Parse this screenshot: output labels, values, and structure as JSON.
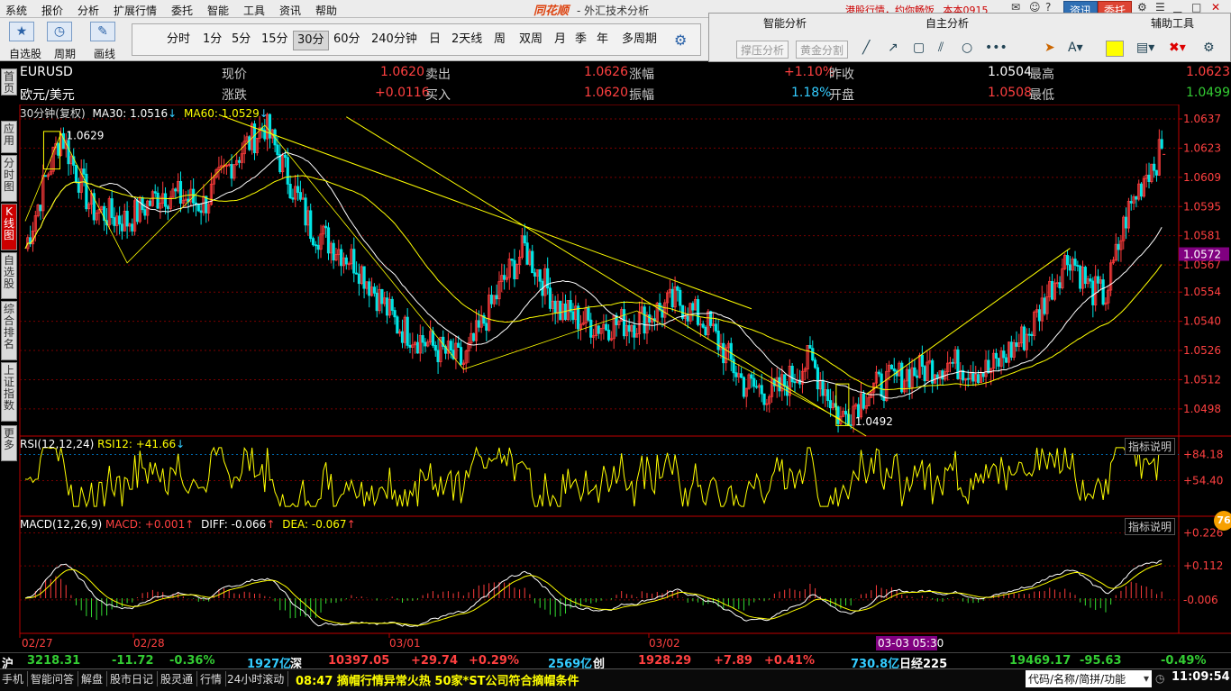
{
  "menu": [
    "系统",
    "报价",
    "分析",
    "扩展行情",
    "委托",
    "智能",
    "工具",
    "资讯",
    "帮助"
  ],
  "brand": "同花顺",
  "subtitle": "- 外汇技术分析",
  "notice": "港股行情，约你畅饭",
  "notice_user": "本本0915",
  "tab_news": "资讯",
  "tab_trade": "委托",
  "toolbar": {
    "captions": [
      "自选股",
      "周期",
      "画线"
    ],
    "periods": [
      "分时",
      "1分",
      "5分",
      "15分",
      "30分",
      "60分",
      "240分钟",
      "日",
      "2天线",
      "周",
      "双周",
      "月",
      "季",
      "年",
      "多周期"
    ],
    "active_period": "30分"
  },
  "right_panel": {
    "smart": "智能分析",
    "self": "自主分析",
    "aux": "辅助工具",
    "btn1": "撑压分析",
    "btn2": "黄金分割"
  },
  "sidebar": [
    "首页",
    "应用",
    "分时图",
    "K线图",
    "自选股",
    "综合排名",
    "上证指数",
    "更多"
  ],
  "quote": {
    "symbol": "EURUSD",
    "name": "欧元/美元",
    "l_now": "现价",
    "now": "1.0620",
    "l_sell": "卖出",
    "sell": "1.0626",
    "l_chg_pct": "涨幅",
    "chg_pct": "+1.10%",
    "l_prev": "昨收",
    "prev": "1.0504",
    "l_high": "最高",
    "high": "1.0623",
    "l_chg": "涨跌",
    "chg": "+0.0116",
    "l_buy": "买入",
    "buy": "1.0620",
    "l_amp": "振幅",
    "amp": "1.18%",
    "l_open": "开盘",
    "open": "1.0508",
    "l_low": "最低",
    "low": "1.0499"
  },
  "ma_header": {
    "period": "30分钟(复权)",
    "ma30": "MA30: 1.0516",
    "ma60": "MA60: 1.0529"
  },
  "rsi_header": {
    "title": "RSI(12,12,24)",
    "val": "RSI12: +41.66"
  },
  "macd_header": {
    "title": "MACD(12,26,9)",
    "macd": "MACD: +0.001",
    "diff": "DIFF: -0.066",
    "dea": "DEA: -0.067"
  },
  "indicator_btn": "指标说明",
  "high_marker": "1.0629",
  "low_marker": "1.0492",
  "price_tag": "1.0572",
  "date_labels": [
    "02/27",
    "02/28",
    "03/01",
    "03/02"
  ],
  "cursor_time": "03-03 05:30",
  "colors": {
    "up": "#ff3b3b",
    "down": "#00e5e5",
    "ma30": "#ffffff",
    "ma60": "#ffff00",
    "grid": "#7a0000",
    "axis": "#c00000"
  },
  "chart_data": [
    {
      "type": "candlestick",
      "title": "EURUSD",
      "yticks": [
        "1.0637",
        "1.0623",
        "1.0609",
        "1.0595",
        "1.0581",
        "1.0567",
        "1.0554",
        "1.0540",
        "1.0526",
        "1.0512",
        "1.0498"
      ],
      "ylim": [
        1.0485,
        1.0637
      ],
      "x": [
        "02/27",
        "02/28",
        "03/01",
        "03/02"
      ],
      "last": 1.062,
      "high": 1.0629,
      "low": 1.0492
    },
    {
      "type": "line",
      "title": "RSI(12,12,24)",
      "yticks": [
        "+84.18",
        "+54.40"
      ],
      "last": 41.66
    },
    {
      "type": "bar",
      "title": "MACD(12,26,9)",
      "yticks": [
        "+0.226",
        "+0.112",
        "-0.006"
      ],
      "macd": 0.001,
      "diff": -0.066,
      "dea": -0.067
    }
  ],
  "index": {
    "sh_l": "沪",
    "sh": "3218.31",
    "sh_chg": "-11.72",
    "sh_pct": "-0.36%",
    "sh_amt": "1927亿",
    "sz_l": "深",
    "sz": "10397.05",
    "sz_chg": "+29.74",
    "sz_pct": "+0.29%",
    "sz_amt": "2569亿",
    "cy_l": "创",
    "cy": "1928.29",
    "cy_chg": "+7.89",
    "cy_pct": "+0.41%",
    "cy_amt": "730.8亿",
    "nk_l": "日经225",
    "nk": "19469.17",
    "nk_chg": "-95.63",
    "nk_pct": "-0.49%"
  },
  "status": {
    "items": [
      "手机",
      "智能问答",
      "解盘",
      "股市日记",
      "股灵通",
      "行情",
      "24小时滚动"
    ],
    "ticker": "08:47 摘帽行情异常火热 50家*ST公司符合摘帽条件",
    "search_placeholder": "代码/名称/简拼/功能",
    "clock": "11:09:54"
  },
  "badge": "76"
}
